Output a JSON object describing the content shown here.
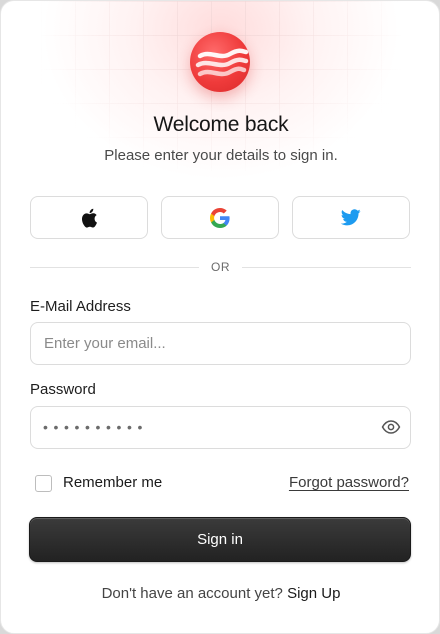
{
  "header": {
    "title": "Welcome back",
    "subtitle": "Please enter your details to sign in."
  },
  "social": [
    {
      "name": "apple-icon"
    },
    {
      "name": "google-icon"
    },
    {
      "name": "twitter-icon"
    }
  ],
  "divider": {
    "label": "OR"
  },
  "email": {
    "label": "E-Mail Address",
    "placeholder": "Enter your email...",
    "value": ""
  },
  "password": {
    "label": "Password",
    "masked_value": "••••••••••"
  },
  "remember": {
    "label": "Remember me",
    "checked": false
  },
  "forgot": {
    "label": "Forgot password?"
  },
  "submit": {
    "label": "Sign in"
  },
  "footer": {
    "prompt": "Don't have an account yet?",
    "link": "Sign Up"
  },
  "colors": {
    "brand": "#ef3b3b",
    "button": "#262626",
    "twitter": "#1d9bf0"
  }
}
